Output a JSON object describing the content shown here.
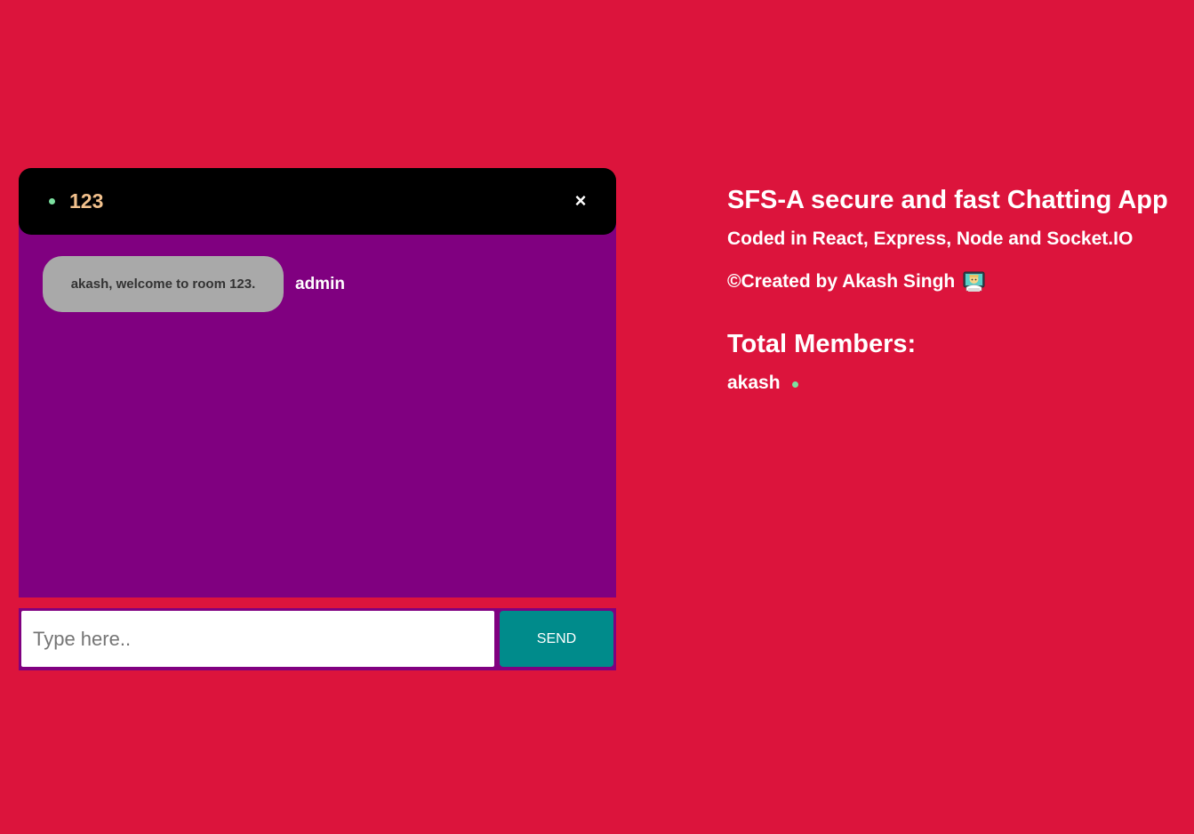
{
  "chat": {
    "room_name": "123",
    "close_symbol": "×",
    "messages": [
      {
        "text": "akash, welcome to room 123.",
        "sender": "admin"
      }
    ],
    "input_placeholder": "Type here..",
    "input_value": "",
    "send_label": "SEND"
  },
  "info": {
    "title": "SFS-A secure and fast Chatting App",
    "tech_line": "Coded in React, Express, Node and Socket.IO",
    "credit_line": "©Created by Akash Singh",
    "credit_icon": "technologist-emoji-icon",
    "members_title": "Total Members:",
    "members": [
      "akash"
    ]
  },
  "colors": {
    "background": "#dc143c",
    "chat_body": "#800080",
    "chat_header": "#000000",
    "room_name": "#f2c18d",
    "online_dot": "#7ce0a0",
    "bubble": "#a9a9a9",
    "send_button": "#008b8b"
  }
}
